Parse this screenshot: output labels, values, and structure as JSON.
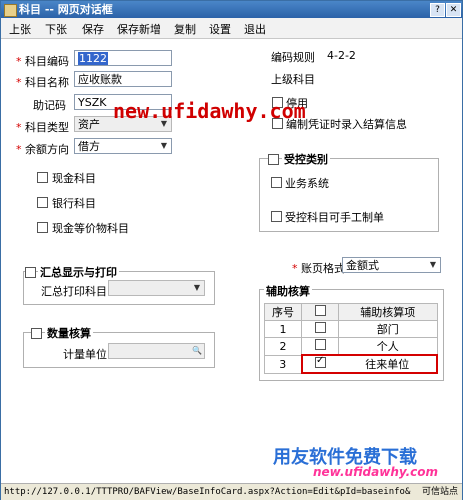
{
  "window": {
    "title": "科目 -- 网页对话框"
  },
  "menu": [
    "上张",
    "下张",
    "保存",
    "保存新增",
    "复制",
    "设置",
    "退出"
  ],
  "form": {
    "code_label": "科目编码",
    "code_value": "1122",
    "name_label": "科目名称",
    "name_value": "应收账款",
    "mnemonic_label": "助记码",
    "mnemonic_value": "YSZK",
    "type_label": "科目类型",
    "type_value": "资产",
    "balance_dir_label": "余额方向",
    "balance_dir_value": "借方",
    "cash_label": "现金科目",
    "bank_label": "银行科目",
    "cash_eq_label": "现金等价物科目",
    "coding_rule_label": "编码规则",
    "coding_rule_value": "4-2-2",
    "parent_label": "上级科目",
    "disabled_label": "停用",
    "settle_label": "编制凭证时录入结算信息"
  },
  "controlled": {
    "title": "受控类别",
    "business_label": "业务系统",
    "manual_label": "受控科目可手工制单"
  },
  "summary": {
    "title": "汇总显示与打印",
    "print_label": "汇总打印科目"
  },
  "quantity": {
    "title": "数量核算",
    "unit_label": "计量单位"
  },
  "ledger": {
    "label": "账页格式",
    "value": "金额式"
  },
  "aux": {
    "title": "辅助核算",
    "col_no": "序号",
    "col_item": "辅助核算项",
    "rows": [
      {
        "no": "1",
        "item": "部门",
        "checked": false
      },
      {
        "no": "2",
        "item": "个人",
        "checked": false
      },
      {
        "no": "3",
        "item": "往来单位",
        "checked": true
      }
    ]
  },
  "watermark": {
    "url": "new.ufidawhy.com",
    "brand": "用友软件免费下载",
    "brand_url": "new.ufidawhy.com"
  },
  "status": {
    "url": "http://127.0.0.1/TTTPRO/BAFView/BaseInfoCard.aspx?Action=Edit&pId=baseinfo&",
    "zone": "可信站点"
  },
  "colors": {
    "title_bar": "#2b62a8",
    "required_star": "#d40000",
    "highlight_box": "#d40000",
    "watermark": "#d00000"
  }
}
